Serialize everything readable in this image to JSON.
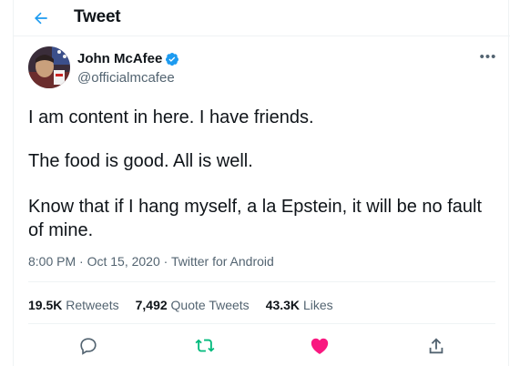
{
  "header": {
    "title": "Tweet"
  },
  "author": {
    "name": "John McAfee",
    "handle": "@officialmcafee",
    "verified": true
  },
  "tweet": {
    "paragraphs": [
      "I am content in here. I have friends.",
      "The food is good. All is well.",
      "Know that if I hang myself, a la Epstein, it will be no fault of mine."
    ],
    "time": "8:00 PM",
    "separator": "·",
    "date": "Oct 15, 2020",
    "source": "Twitter for Android"
  },
  "stats": {
    "retweets_count": "19.5K",
    "retweets_label": "Retweets",
    "quotes_count": "7,492",
    "quotes_label": "Quote Tweets",
    "likes_count": "43.3K",
    "likes_label": "Likes"
  },
  "actions": [
    "reply-icon",
    "retweet-icon",
    "like-icon",
    "share-icon"
  ],
  "colors": {
    "accent": "#1d9bf0",
    "retweet": "#00ba7c",
    "like": "#f91880",
    "secondary": "#536471"
  }
}
